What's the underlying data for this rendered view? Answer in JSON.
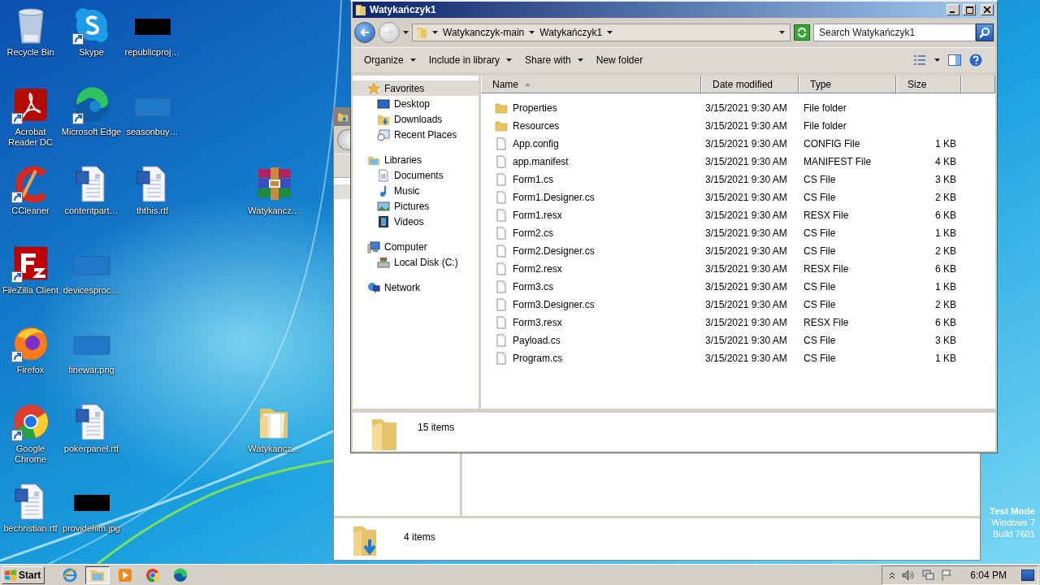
{
  "desktop_icons": [
    {
      "label": "Recycle Bin",
      "kind": "recycle",
      "shortcut": false
    },
    {
      "label": "Skype",
      "kind": "skype",
      "shortcut": true
    },
    {
      "label": "republicproj…",
      "kind": "dark",
      "shortcut": false
    },
    {
      "label": "Acrobat Reader DC",
      "kind": "acrobat",
      "shortcut": true
    },
    {
      "label": "Microsoft Edge",
      "kind": "edge",
      "shortcut": true
    },
    {
      "label": "seasonbuy…",
      "kind": "blank",
      "shortcut": false
    },
    {
      "label": "CCleaner",
      "kind": "ccleaner",
      "shortcut": true
    },
    {
      "label": "contentpart…",
      "kind": "word",
      "shortcut": false
    },
    {
      "label": "ththis.rtf",
      "kind": "word",
      "shortcut": false
    },
    {
      "label": "Watykancz…",
      "kind": "archive",
      "shortcut": false
    },
    {
      "label": "FileZilla Client",
      "kind": "filezilla",
      "shortcut": true
    },
    {
      "label": "devicesproc…",
      "kind": "blank",
      "shortcut": false
    },
    {
      "label": "Firefox",
      "kind": "firefox",
      "shortcut": true
    },
    {
      "label": "finewar.png",
      "kind": "blank",
      "shortcut": false
    },
    {
      "label": "Google Chrome",
      "kind": "chrome",
      "shortcut": true
    },
    {
      "label": "pokerpanel.rtf",
      "kind": "word",
      "shortcut": false
    },
    {
      "label": "Watykancz…",
      "kind": "folder",
      "shortcut": false
    },
    {
      "label": "bechristian.rtf",
      "kind": "word",
      "shortcut": false
    },
    {
      "label": "providefilm.jpg",
      "kind": "dark",
      "shortcut": false
    }
  ],
  "back_window": {
    "status": "4 items"
  },
  "explorer": {
    "title": "Watykańczyk1",
    "breadcrumb": [
      "Watykanczyk-main",
      "Watykańczyk1"
    ],
    "search": {
      "placeholder": "Search Watykańczyk1"
    },
    "toolbar": [
      {
        "label": "Organize",
        "dropdown": true
      },
      {
        "label": "Include in library",
        "dropdown": true
      },
      {
        "label": "Share with",
        "dropdown": true
      },
      {
        "label": "New folder",
        "dropdown": false
      }
    ],
    "nav": [
      {
        "label": "Favorites",
        "kind": "star",
        "selected": true,
        "children": [
          {
            "label": "Desktop",
            "kind": "desktop",
            "selected": false
          },
          {
            "label": "Downloads",
            "kind": "downloads",
            "selected": false
          },
          {
            "label": "Recent Places",
            "kind": "recent",
            "selected": false
          }
        ]
      },
      {
        "label": "Libraries",
        "kind": "library",
        "selected": false,
        "children": [
          {
            "label": "Documents",
            "kind": "documents",
            "selected": false
          },
          {
            "label": "Music",
            "kind": "music",
            "selected": false
          },
          {
            "label": "Pictures",
            "kind": "pictures",
            "selected": false
          },
          {
            "label": "Videos",
            "kind": "videos",
            "selected": false
          }
        ]
      },
      {
        "label": "Computer",
        "kind": "computer",
        "selected": false,
        "children": [
          {
            "label": "Local Disk (C:)",
            "kind": "disk",
            "selected": false
          }
        ]
      },
      {
        "label": "Network",
        "kind": "network",
        "selected": false
      }
    ],
    "columns": [
      {
        "label": "Name",
        "sorted": true
      },
      {
        "label": "Date modified",
        "sorted": false
      },
      {
        "label": "Type",
        "sorted": false
      },
      {
        "label": "Size",
        "sorted": false
      }
    ],
    "rows": [
      {
        "name": "Properties",
        "kind": "folder",
        "date": "3/15/2021 9:30 AM",
        "type": "File folder"
      },
      {
        "name": "Resources",
        "kind": "folder",
        "date": "3/15/2021 9:30 AM",
        "type": "File folder"
      },
      {
        "name": "App.config",
        "kind": "file",
        "date": "3/15/2021 9:30 AM",
        "type": "CONFIG File",
        "size": "1 KB"
      },
      {
        "name": "app.manifest",
        "kind": "file",
        "date": "3/15/2021 9:30 AM",
        "type": "MANIFEST File",
        "size": "4 KB"
      },
      {
        "name": "Form1.cs",
        "kind": "file",
        "date": "3/15/2021 9:30 AM",
        "type": "CS File",
        "size": "3 KB"
      },
      {
        "name": "Form1.Designer.cs",
        "kind": "file",
        "date": "3/15/2021 9:30 AM",
        "type": "CS File",
        "size": "2 KB"
      },
      {
        "name": "Form1.resx",
        "kind": "file",
        "date": "3/15/2021 9:30 AM",
        "type": "RESX File",
        "size": "6 KB"
      },
      {
        "name": "Form2.cs",
        "kind": "file",
        "date": "3/15/2021 9:30 AM",
        "type": "CS File",
        "size": "1 KB"
      },
      {
        "name": "Form2.Designer.cs",
        "kind": "file",
        "date": "3/15/2021 9:30 AM",
        "type": "CS File",
        "size": "2 KB"
      },
      {
        "name": "Form2.resx",
        "kind": "file",
        "date": "3/15/2021 9:30 AM",
        "type": "RESX File",
        "size": "6 KB"
      },
      {
        "name": "Form3.cs",
        "kind": "file",
        "date": "3/15/2021 9:30 AM",
        "type": "CS File",
        "size": "1 KB"
      },
      {
        "name": "Form3.Designer.cs",
        "kind": "file",
        "date": "3/15/2021 9:30 AM",
        "type": "CS File",
        "size": "2 KB"
      },
      {
        "name": "Form3.resx",
        "kind": "file",
        "date": "3/15/2021 9:30 AM",
        "type": "RESX File",
        "size": "6 KB"
      },
      {
        "name": "Payload.cs",
        "kind": "file",
        "date": "3/15/2021 9:30 AM",
        "type": "CS File",
        "size": "3 KB"
      },
      {
        "name": "Program.cs",
        "kind": "file",
        "date": "3/15/2021 9:30 AM",
        "type": "CS File",
        "size": "1 KB"
      }
    ],
    "status": "15 items"
  },
  "taskbar": {
    "start": "Start",
    "apps": [
      {
        "kind": "ie",
        "selected": false
      },
      {
        "kind": "explorer",
        "selected": true
      },
      {
        "kind": "media",
        "selected": false
      },
      {
        "kind": "chrome",
        "selected": false
      },
      {
        "kind": "edge",
        "selected": false
      }
    ],
    "clock": "6:04 PM"
  },
  "test_mode": [
    "Test Mode",
    "Windows 7",
    "Build 7601"
  ]
}
